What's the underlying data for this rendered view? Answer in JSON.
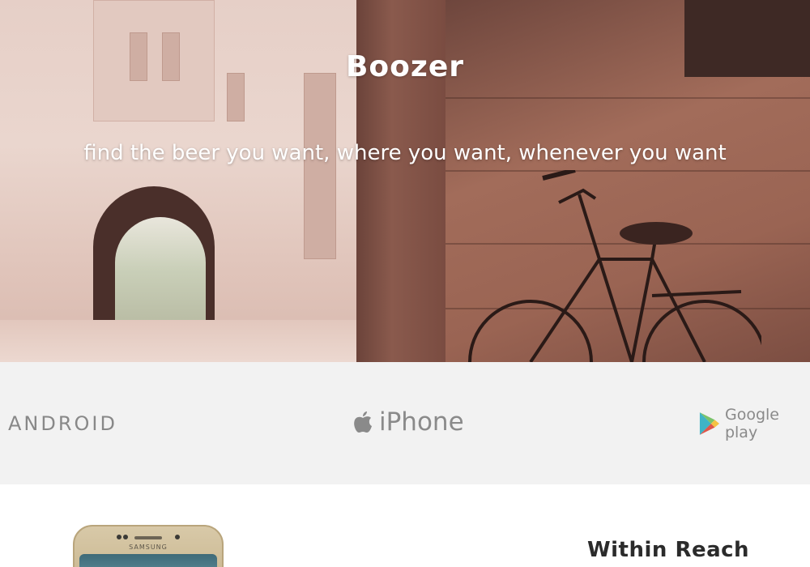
{
  "hero": {
    "title": "Boozer",
    "tagline": "find the beer you want, where you want, whenever you want"
  },
  "platforms": {
    "android": "ANDROID",
    "iphone": "iPhone",
    "google_play": "Google play"
  },
  "feature": {
    "title": "Within Reach",
    "phone_brand": "SAMSUNG"
  },
  "colors": {
    "platform_band": "#f2f2f2",
    "platform_text": "#8a8a8a",
    "title_text": "#2b2b2b"
  }
}
